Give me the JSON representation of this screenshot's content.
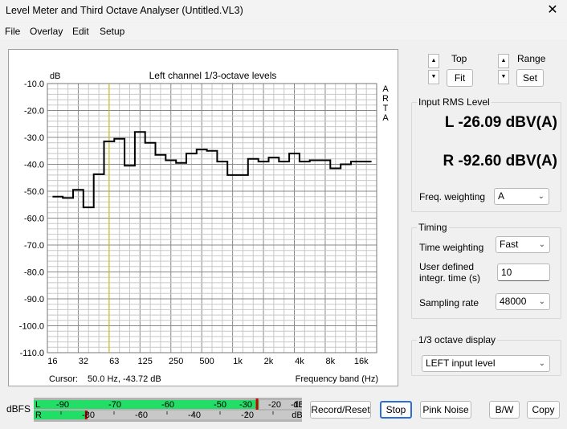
{
  "window": {
    "title": "Level Meter and Third Octave Analyser (Untitled.VL3)",
    "close_glyph": "✕"
  },
  "menu": [
    "File",
    "Overlay",
    "Edit",
    "Setup"
  ],
  "graph": {
    "unit_label": "dB",
    "title": "Left channel 1/3-octave levels",
    "watermark": [
      "A",
      "R",
      "T",
      "A"
    ],
    "y_ticks": [
      "-10.0",
      "-20.0",
      "-30.0",
      "-40.0",
      "-50.0",
      "-60.0",
      "-70.0",
      "-80.0",
      "-90.0",
      "-100.0",
      "-110.0"
    ],
    "x_ticks": [
      "16",
      "32",
      "63",
      "125",
      "250",
      "500",
      "1k",
      "2k",
      "4k",
      "8k",
      "16k"
    ],
    "cursor_label": "Cursor:",
    "cursor_value": "50.0 Hz, -43.72 dB",
    "x_axis_label": "Frequency band (Hz)",
    "cursor_band_index": 5,
    "trace_color": "#000000",
    "cursor_color": "#d4c000"
  },
  "chart_data": {
    "type": "line",
    "title": "Left channel 1/3-octave levels",
    "xlabel": "Frequency band (Hz)",
    "ylabel": "dB",
    "ylim": [
      -110,
      -10
    ],
    "bands": [
      "16",
      "20",
      "25",
      "31.5",
      "40",
      "50",
      "63",
      "80",
      "100",
      "125",
      "160",
      "200",
      "250",
      "315",
      "400",
      "500",
      "630",
      "800",
      "1k",
      "1.25k",
      "1.6k",
      "2k",
      "2.5k",
      "3.15k",
      "4k",
      "5k",
      "6.3k",
      "8k",
      "10k",
      "12.5k",
      "16k"
    ],
    "series": [
      {
        "values": [
          -52,
          -52.5,
          -49.5,
          -56,
          -43.7,
          -31.5,
          -30.5,
          -40.5,
          -28,
          -32,
          -36.5,
          -38.5,
          -39.5,
          -36,
          -34.5,
          -35,
          -39,
          -44,
          -44,
          -38,
          -39,
          -37.5,
          -39,
          -36,
          -39,
          -38.5,
          -38.5,
          -41.5,
          -40,
          -39,
          -39
        ]
      }
    ]
  },
  "controls": {
    "top_label": "Top",
    "fit_label": "Fit",
    "range_label": "Range",
    "set_label": "Set",
    "up_glyph": "▲",
    "down_glyph": "▼"
  },
  "input_rms": {
    "group_label": "Input RMS Level",
    "left_value": "L -26.09 dBV(A)",
    "right_value": "R -92.60 dBV(A)",
    "freq_weighting_label": "Freq. weighting",
    "freq_weighting_value": "A"
  },
  "timing": {
    "group_label": "Timing",
    "time_weighting_label": "Time weighting",
    "time_weighting_value": "Fast",
    "user_defined_label_1": "User defined",
    "user_defined_label_2": "integr. time (s)",
    "user_defined_value": "10",
    "sampling_rate_label": "Sampling rate",
    "sampling_rate_value": "48000"
  },
  "octave_display": {
    "group_label": "1/3 octave display",
    "value": "LEFT input level"
  },
  "meter": {
    "label": "dBFS",
    "channel_l": "L",
    "channel_r": "R",
    "top_ticks": [
      "-90",
      "-70",
      "-60",
      "-50",
      "-30",
      "-20",
      "-10",
      "dB"
    ],
    "bottom_ticks": [
      "-80",
      "-60",
      "-40",
      "-20",
      "dB"
    ],
    "left_level": 0.84,
    "right_level": 0.2,
    "fill_color": "#22dd66",
    "peak_color": "#cc0000"
  },
  "buttons": {
    "record_reset": "Record/Reset",
    "stop": "Stop",
    "pink_noise": "Pink Noise",
    "bw": "B/W",
    "copy": "Copy"
  }
}
